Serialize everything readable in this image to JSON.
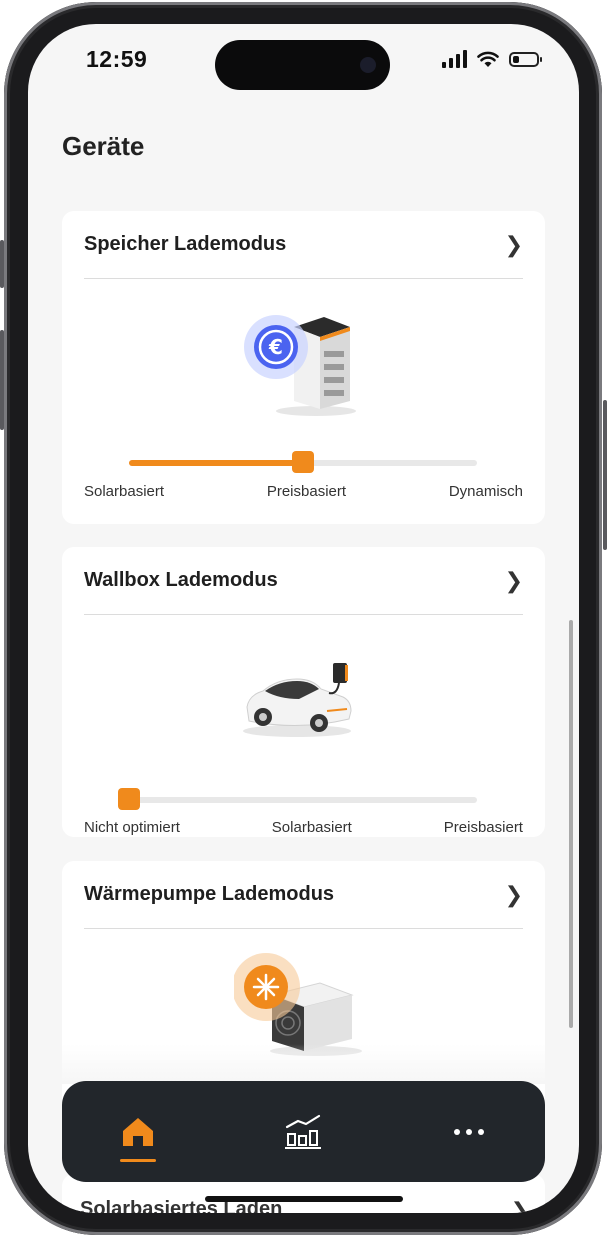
{
  "status": {
    "time": "12:59",
    "battery_level": 0.25
  },
  "page": {
    "title": "Geräte"
  },
  "cards": [
    {
      "title": "Speicher Lademodus",
      "slider_labels": [
        "Solarbasiert",
        "Preisbasiert",
        "Dynamisch"
      ],
      "selected_index": 1,
      "illustration": "battery-storage-euro-icon"
    },
    {
      "title": "Wallbox Lademodus",
      "slider_labels": [
        "Nicht optimiert",
        "Solarbasiert",
        "Preisbasiert"
      ],
      "selected_index": 0,
      "illustration": "car-wallbox-icon"
    },
    {
      "title": "Wärmepumpe Lademodus",
      "illustration": "heat-pump-sun-icon"
    }
  ],
  "next_card": {
    "title": "Solarbasiertes Laden"
  },
  "nav": {
    "items": [
      "home-icon",
      "chart-icon",
      "more-icon"
    ],
    "active": 0
  },
  "colors": {
    "accent": "#f08a1c",
    "nav_bg": "#22262b",
    "screen_bg": "#f6f6f6"
  }
}
